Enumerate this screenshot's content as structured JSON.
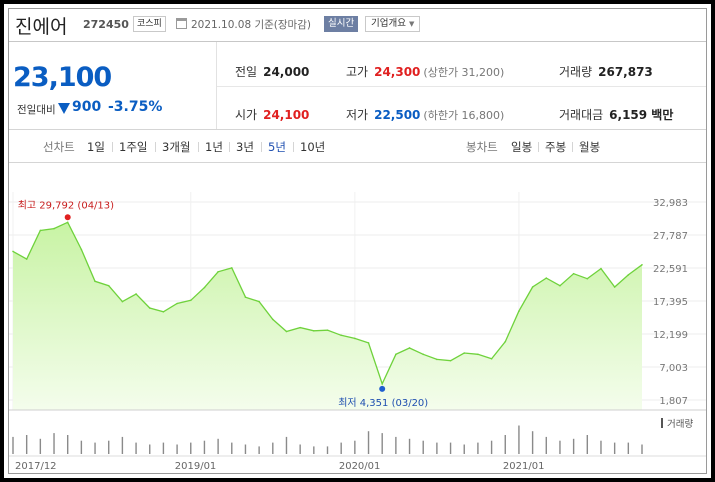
{
  "header": {
    "stock_name": "진에어",
    "stock_code": "272450",
    "market": "코스피",
    "date": "2021.10.08 기준(장마감)",
    "realtime": "실시간",
    "company_info": "기업개요"
  },
  "summary": {
    "price": "23,100",
    "change_label": "전일대비",
    "change_value": "900",
    "change_rate": "-3.75%",
    "prev_close_label": "전일",
    "prev_close": "24,000",
    "open_label": "시가",
    "open": "24,100",
    "high_label": "고가",
    "high": "24,300",
    "upper_limit": "(상한가 31,200)",
    "low_label": "저가",
    "low": "22,500",
    "lower_limit": "(하한가 16,800)",
    "volume_label": "거래량",
    "volume": "267,873",
    "amount_label": "거래대금",
    "amount": "6,159 백만"
  },
  "toolbar": {
    "line_chart": "선차트",
    "periods": [
      "1일",
      "1주일",
      "3개월",
      "1년",
      "3년",
      "5년",
      "10년"
    ],
    "active_period": "5년",
    "candle_chart": "봉차트",
    "candle_periods": [
      "일봉",
      "주봉",
      "월봉"
    ]
  },
  "colors": {
    "price_down": "#0a5dc2",
    "price_up": "#e02020",
    "line": "#6fd23c",
    "area_top": "#c8f3a4",
    "area_bottom": "#f4fdec",
    "volume_bar": "#8a8a8a"
  },
  "chart_data": {
    "type": "area",
    "x": [
      "2017-12",
      "2018-01",
      "2018-02",
      "2018-03",
      "2018-04",
      "2018-05",
      "2018-06",
      "2018-07",
      "2018-08",
      "2018-09",
      "2018-10",
      "2018-11",
      "2018-12",
      "2019-01",
      "2019-02",
      "2019-03",
      "2019-04",
      "2019-05",
      "2019-06",
      "2019-07",
      "2019-08",
      "2019-09",
      "2019-10",
      "2019-11",
      "2019-12",
      "2020-01",
      "2020-02",
      "2020-03",
      "2020-04",
      "2020-05",
      "2020-06",
      "2020-07",
      "2020-08",
      "2020-09",
      "2020-10",
      "2020-11",
      "2020-12",
      "2021-01",
      "2021-02",
      "2021-03",
      "2021-04",
      "2021-05",
      "2021-06",
      "2021-07",
      "2021-08",
      "2021-09",
      "2021-10"
    ],
    "y": [
      25200,
      24000,
      28500,
      28800,
      29792,
      25500,
      20500,
      19800,
      17300,
      18500,
      16300,
      15700,
      17000,
      17500,
      19500,
      22000,
      22600,
      18000,
      17300,
      14500,
      12600,
      13200,
      12700,
      12800,
      12000,
      11500,
      10800,
      4351,
      9000,
      10000,
      9000,
      8200,
      8000,
      9200,
      9000,
      8300,
      11000,
      15800,
      19600,
      21000,
      19800,
      21700,
      20900,
      22500,
      19600,
      21500,
      23100
    ],
    "volume": [
      0.45,
      0.5,
      0.4,
      0.55,
      0.5,
      0.35,
      0.3,
      0.35,
      0.45,
      0.3,
      0.25,
      0.3,
      0.25,
      0.3,
      0.35,
      0.4,
      0.3,
      0.25,
      0.2,
      0.3,
      0.45,
      0.25,
      0.2,
      0.2,
      0.3,
      0.35,
      0.6,
      0.55,
      0.45,
      0.4,
      0.35,
      0.3,
      0.3,
      0.25,
      0.3,
      0.35,
      0.5,
      0.75,
      0.6,
      0.45,
      0.35,
      0.4,
      0.5,
      0.35,
      0.3,
      0.3,
      0.25
    ],
    "y_ticks": [
      "32,983",
      "27,787",
      "22,591",
      "17,395",
      "12,199",
      "7,003",
      "1,807"
    ],
    "ylim": [
      1807,
      32983
    ],
    "x_tick_labels": [
      "2017/12",
      "2019/01",
      "2020/01",
      "2021/01"
    ],
    "max_label": "최고 29,792 (04/13)",
    "min_label": "최저 4,351 (03/20)",
    "volume_legend": "거래량",
    "grid": true
  }
}
